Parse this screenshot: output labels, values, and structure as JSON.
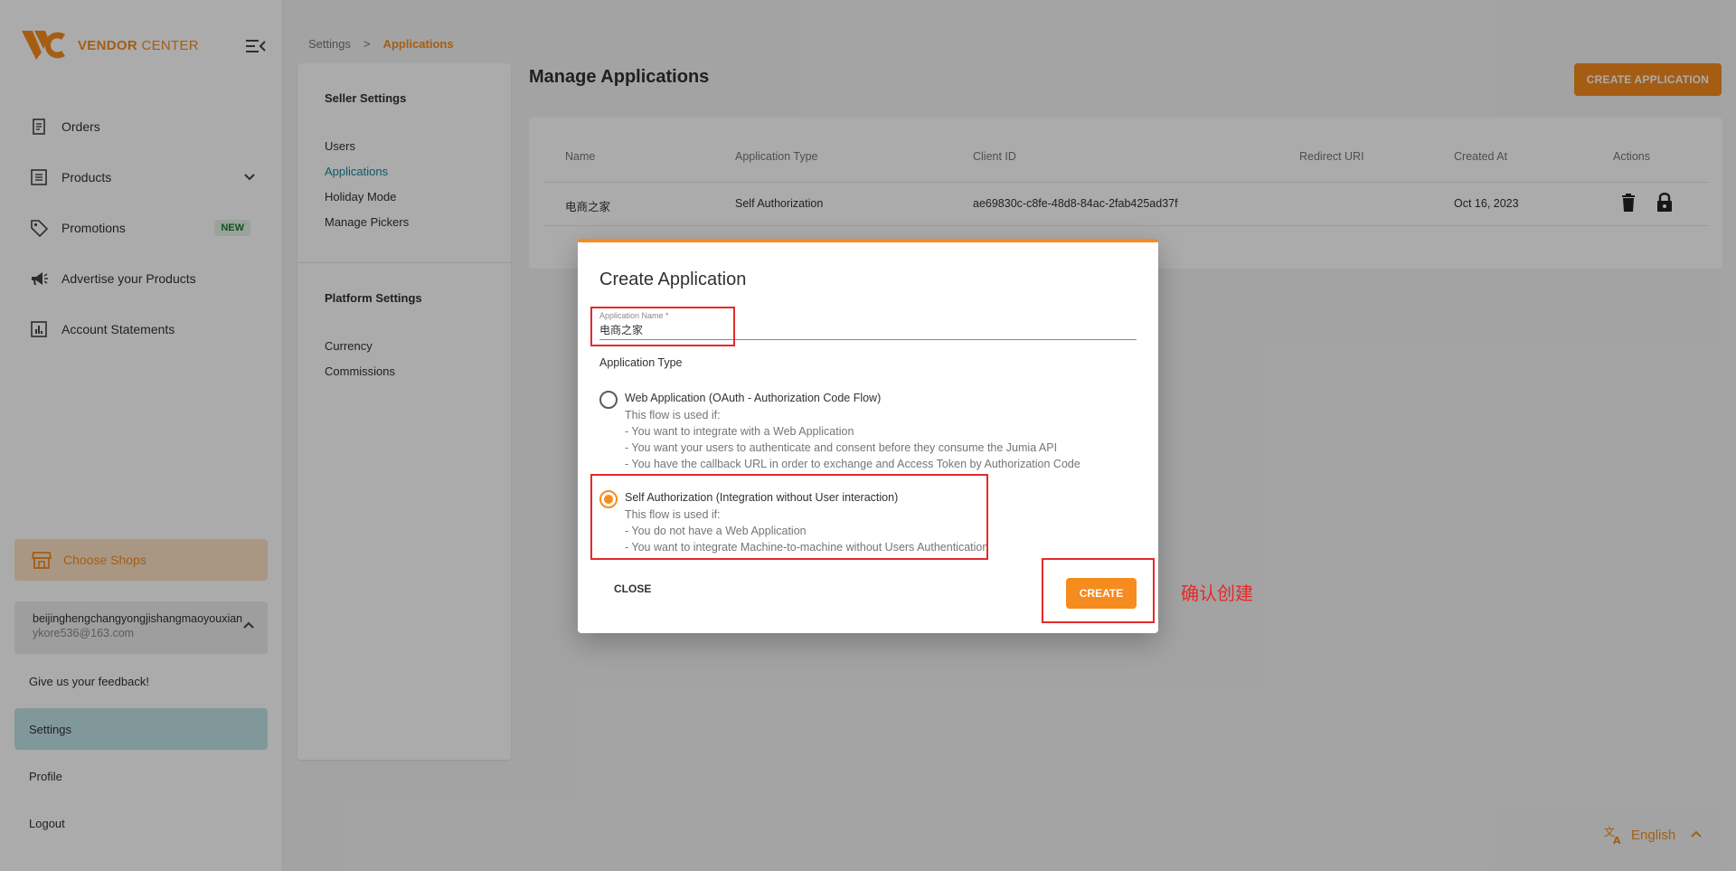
{
  "brand": {
    "name_bold": "VENDOR",
    "name_light": "CENTER",
    "color": "#f68b1e"
  },
  "sidebar": {
    "items": [
      {
        "label": "Orders",
        "icon": "receipt-icon"
      },
      {
        "label": "Products",
        "icon": "list-icon"
      },
      {
        "label": "Promotions",
        "icon": "tag-icon",
        "badge": "NEW"
      },
      {
        "label": "Advertise your Products",
        "icon": "megaphone-icon"
      },
      {
        "label": "Account Statements",
        "icon": "chart-icon"
      }
    ],
    "choose_shops": "Choose Shops",
    "account": {
      "name": "beijinghengchangyongjishangmaoyouxian",
      "email": "ykore536@163.com"
    },
    "feedback": "Give us your feedback!",
    "settings": "Settings",
    "profile": "Profile",
    "logout": "Logout"
  },
  "breadcrumb": {
    "root": "Settings",
    "separator": ">",
    "current": "Applications"
  },
  "settings_panel": {
    "seller_heading": "Seller Settings",
    "seller_links": [
      "Users",
      "Applications",
      "Holiday Mode",
      "Manage Pickers"
    ],
    "platform_heading": "Platform Settings",
    "platform_links": [
      "Currency",
      "Commissions"
    ]
  },
  "main": {
    "title": "Manage Applications",
    "create_button": "CREATE APPLICATION",
    "table": {
      "headers": [
        "Name",
        "Application Type",
        "Client ID",
        "Redirect URI",
        "Created At",
        "Actions"
      ],
      "rows": [
        {
          "name": "电商之家",
          "type": "Self Authorization",
          "client_id": "ae69830c-c8fe-48d8-84ac-2fab425ad37f",
          "redirect_uri": "",
          "created_at": "Oct 16, 2023"
        }
      ]
    }
  },
  "language": "English",
  "dialog": {
    "title": "Create Application",
    "name_label": "Application Name *",
    "name_value": "电商之家",
    "type_label": "Application Type",
    "options": [
      {
        "title": "Web Application (OAuth - Authorization Code Flow)",
        "selected": false,
        "lines": [
          "This flow is used if:",
          "- You want to integrate with a Web Application",
          "- You want your users to authenticate and consent before they consume the Jumia API",
          "- You have the callback URL in order to exchange and Access Token by Authorization Code"
        ]
      },
      {
        "title": "Self Authorization (Integration without User interaction)",
        "selected": true,
        "lines": [
          "This flow is used if:",
          "- You do not have a Web Application",
          "- You want to integrate Machine-to-machine without Users Authentication"
        ]
      }
    ],
    "close": "CLOSE",
    "create": "CREATE"
  },
  "annotation": {
    "note": "确认创建",
    "color": "#e32a2a"
  }
}
